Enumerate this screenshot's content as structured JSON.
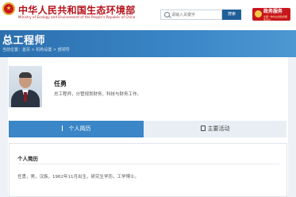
{
  "header": {
    "ministry_name": "中华人民共和国生态环境部",
    "ministry_name_en": "Ministry of Ecology and Environment of the People's Republic of China",
    "search_placeholder": "请输入关键字",
    "search_button": "搜索",
    "gov_badge_line1": "政务服务",
    "gov_badge_line2": "全国一体化在线政务服务平台"
  },
  "title_band": {
    "page_title": "总工程师",
    "breadcrumb": "当前位置：首页 > 机构设置 > 部领导"
  },
  "profile": {
    "name": "任勇",
    "position": "总工程师，分管规划财务、科技与财务工作。"
  },
  "tabs": [
    {
      "label": "个人简历"
    },
    {
      "label": "主要活动"
    }
  ],
  "resume": {
    "heading": "个人简历",
    "bio": "任勇，男，汉族，1962年11月出生，研究生学历，工学博士。"
  },
  "colors": {
    "brand_red": "#b5121b",
    "band_blue": "#3a86c6",
    "button_blue": "#1f5e99"
  }
}
